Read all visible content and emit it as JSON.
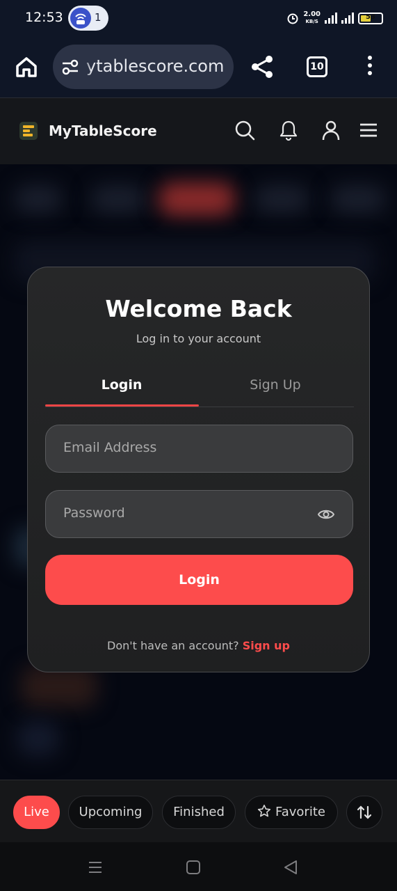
{
  "status_bar": {
    "time": "12:53",
    "notification_count": "1",
    "net_speed": "2.00",
    "net_unit": "KB/S",
    "battery": "53"
  },
  "browser": {
    "url": "ytablescore.com",
    "tab_count": "10"
  },
  "header": {
    "brand": "MyTableScore",
    "icons": [
      "search-icon",
      "bell-icon",
      "user-icon",
      "menu-icon"
    ]
  },
  "modal": {
    "title": "Welcome Back",
    "subtitle": "Log in to your account",
    "tabs": [
      {
        "label": "Login",
        "active": true
      },
      {
        "label": "Sign Up",
        "active": false
      }
    ],
    "email_placeholder": "Email Address",
    "password_placeholder": "Password",
    "login_button": "Login",
    "footer_prompt": "Don't have an account?",
    "footer_link": "Sign up"
  },
  "filters": [
    {
      "label": "Live",
      "active": true
    },
    {
      "label": "Upcoming",
      "active": false
    },
    {
      "label": "Finished",
      "active": false
    },
    {
      "label": "Favorite",
      "active": false,
      "icon": "star-icon"
    }
  ],
  "colors": {
    "accent": "#fd4c4c",
    "modal_bg": "#242526",
    "header_bg": "#15171b"
  }
}
